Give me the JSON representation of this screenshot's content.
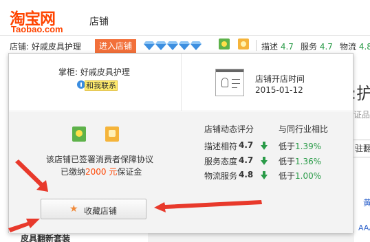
{
  "header": {
    "logo_cn": "淘宝网",
    "logo_en": "Taobao.com",
    "section_title": "店铺"
  },
  "shopbar": {
    "shop_label": "店铺:  好戚皮具护理",
    "enter_button": "进入店铺",
    "scores": [
      {
        "label": "描述",
        "value": "4.7"
      },
      {
        "label": "服务",
        "value": "4.7"
      },
      {
        "label": "物流",
        "value": "4.8"
      }
    ]
  },
  "popup": {
    "keeper_label": "掌柜: 好戚皮具护理",
    "contact_button": "和我联系",
    "open_time_label": "店铺开店时间",
    "open_time_value": "2015-01-12",
    "agreement_line1": "该店铺已签署消费者保障协议",
    "agreement_prefix": "已缴纳",
    "agreement_amount": "2000 元",
    "agreement_suffix": "保证金",
    "rating_title": "店铺动态评分",
    "compare_title": "与同行业相比",
    "ratings": [
      {
        "label": "描述相符",
        "score": "4.7",
        "compare_prefix": "低于",
        "compare_value": "1.39%"
      },
      {
        "label": "服务态度",
        "score": "4.7",
        "compare_prefix": "低于",
        "compare_value": "1.36%"
      },
      {
        "label": "物流服务",
        "score": "4.8",
        "compare_prefix": "低于",
        "compare_value": "1.00%"
      }
    ],
    "favorite_button": "收藏店铺"
  },
  "background_page": {
    "big_char": ":护",
    "cert_text": "证品",
    "box_text": "驻翻",
    "side_link": "黄",
    "aaa_text": "AAA",
    "bottom_text": "皮具翻新套装"
  },
  "colors": {
    "brand": "#ff4400",
    "enter_button_bg": "#f2703a",
    "score_green": "#2a9b48",
    "diamond_blue": "#3d8fe0",
    "arrow_red": "#e8392b"
  },
  "icons": {
    "diamonds": [
      "diamond-icon",
      "diamond-icon",
      "diamond-icon",
      "diamond-icon",
      "diamond-icon"
    ],
    "consumer_protection": "shield-badge-icon",
    "deposit": "shopping-bag-icon",
    "id_card": "id-card-icon",
    "star": "star-icon",
    "down_arrow": "down-arrow-icon",
    "annotation_arrows": [
      "red-arrow-icon",
      "red-arrow-icon",
      "red-arrow-icon"
    ]
  }
}
